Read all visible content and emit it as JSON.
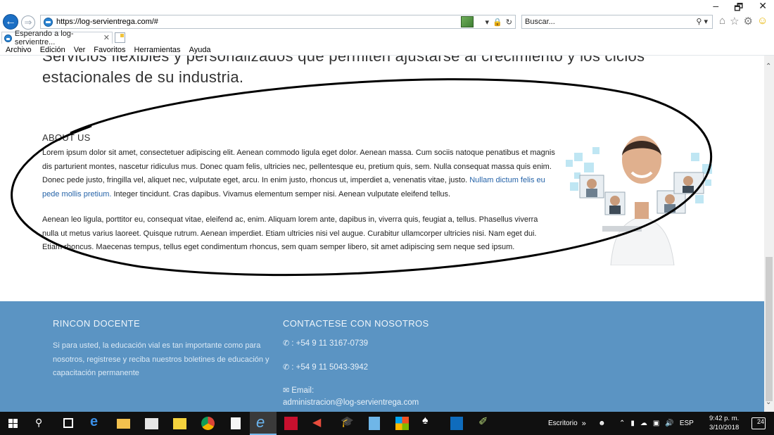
{
  "browser": {
    "url": "https://log-servientrega.com/#",
    "search_placeholder": "Buscar...",
    "tab_title": "Esperando a log-servientre...",
    "menu": [
      "Archivo",
      "Edición",
      "Ver",
      "Favoritos",
      "Herramientas",
      "Ayuda"
    ],
    "window_controls": [
      "–",
      "🗗",
      "✕"
    ]
  },
  "page": {
    "heading_line1": "Servicios flexibles y personalizados que permiten ajustarse al crecimiento y los ciclos",
    "heading_line2": "estacionales de su industria.",
    "about": {
      "title": "ABOUT US",
      "p1_text": "Lorem ipsum dolor sit amet, consectetuer adipiscing elit. Aenean commodo ligula eget dolor. Aenean massa. Cum sociis natoque penatibus et magnis dis parturient montes, nascetur ridiculus mus. Donec quam felis, ultricies nec, pellentesque eu, pretium quis, sem. Nulla consequat massa quis enim. Donec pede justo, fringilla vel, aliquet nec, vulputate eget, arcu. In enim justo, rhoncus ut, imperdiet a, venenatis vitae, justo.",
      "p1_link": "Nullam dictum felis eu pede mollis pretium.",
      "p1_tail": " Integer tincidunt. Cras dapibus. Vivamus elementum semper nisi. Aenean vulputate eleifend tellus.",
      "p2_text": "Aenean leo ligula, porttitor eu, consequat vitae, eleifend ac, enim. Aliquam lorem ante, dapibus in, viverra quis, feugiat a, tellus. Phasellus viverra nulla ut metus varius laoreet. Quisque rutrum. Aenean imperdiet. Etiam ultricies nisi vel augue. Curabitur ullamcorper ultricies nisi. Nam eget dui. Etiam rhoncus. Maecenas tempus, tellus eget condimentum rhoncus, sem quam semper libero, sit amet adipiscing sem neque sed ipsum."
    },
    "footer": {
      "col1_title": "RINCON DOCENTE",
      "col1_text": "Si para usted, la educación vial es tan importante como para nosotros, registrese y reciba nuestros boletines de educación y capacitación permanente",
      "col2_title": "CONTACTESE CON NOSOTROS",
      "phone1": ": +54 9 11 3167-0739",
      "phone2": ": +54 9 11 5043-3942",
      "email_label": "Email:",
      "email": "administracion@log-servientrega.com"
    }
  },
  "taskbar": {
    "desktop_label": "Escritorio",
    "lang": "ESP",
    "time": "9:42 p. m.",
    "date": "3/10/2018",
    "notifications": "24"
  },
  "colors": {
    "footer_bg": "#5b94c3",
    "link": "#2563a8",
    "taskbar": "#101010"
  }
}
